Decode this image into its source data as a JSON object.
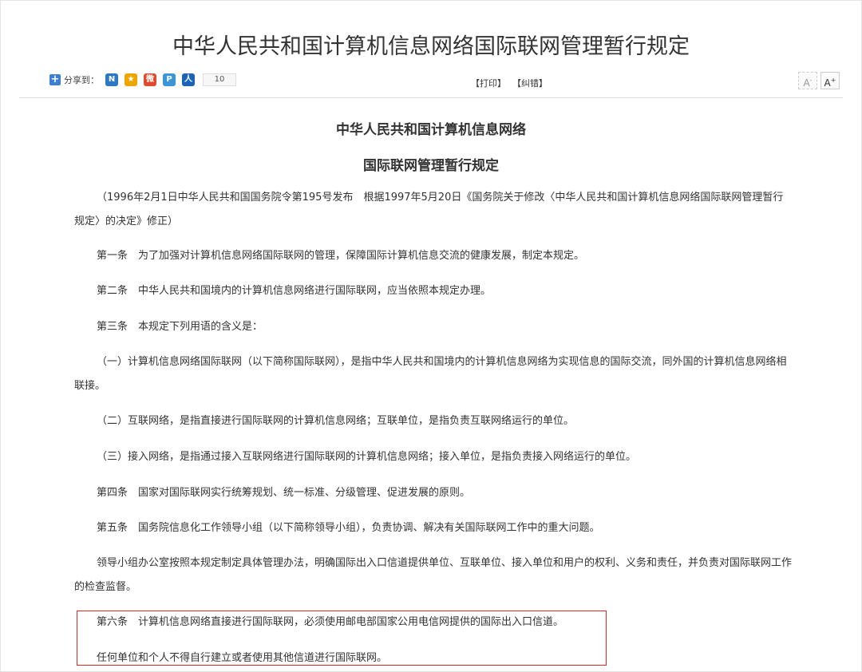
{
  "page": {
    "title": "中华人民共和国计算机信息网络国际联网管理暂行规定"
  },
  "share": {
    "label": "分享到：",
    "count": "10",
    "services": [
      {
        "icon": "renren-icon",
        "glyph": "N"
      },
      {
        "icon": "qzone-icon",
        "glyph": "★"
      },
      {
        "icon": "weibo-icon",
        "glyph": "微"
      },
      {
        "icon": "tencent-weibo-icon",
        "glyph": "P"
      },
      {
        "icon": "people-icon",
        "glyph": "人"
      }
    ]
  },
  "toolbar": {
    "print_label": "【打印】",
    "correct_label": "【纠错】",
    "font_smaller": "A",
    "font_larger": "A"
  },
  "doc": {
    "heading_line1": "中华人民共和国计算机信息网络",
    "heading_line2": "国际联网管理暂行规定",
    "paragraphs": [
      "（1996年2月1日中华人民共和国国务院令第195号发布　根据1997年5月20日《国务院关于修改〈中华人民共和国计算机信息网络国际联网管理暂行规定〉的决定》修正）",
      "第一条　为了加强对计算机信息网络国际联网的管理，保障国际计算机信息交流的健康发展，制定本规定。",
      "第二条　中华人民共和国境内的计算机信息网络进行国际联网，应当依照本规定办理。",
      "第三条　本规定下列用语的含义是：",
      "（一）计算机信息网络国际联网（以下简称国际联网），是指中华人民共和国境内的计算机信息网络为实现信息的国际交流，同外国的计算机信息网络相联接。",
      "（二）互联网络，是指直接进行国际联网的计算机信息网络；互联单位，是指负责互联网络运行的单位。",
      "（三）接入网络，是指通过接入互联网络进行国际联网的计算机信息网络；接入单位，是指负责接入网络运行的单位。",
      "第四条　国家对国际联网实行统筹规划、统一标准、分级管理、促进发展的原则。",
      "第五条　国务院信息化工作领导小组（以下简称领导小组），负责协调、解决有关国际联网工作中的重大问题。",
      "领导小组办公室按照本规定制定具体管理办法，明确国际出入口信道提供单位、互联单位、接入单位和用户的权利、义务和责任，并负责对国际联网工作的检查监督。",
      "第六条　计算机信息网络直接进行国际联网，必须使用邮电部国家公用电信网提供的国际出入口信道。",
      "任何单位和个人不得自行建立或者使用其他信道进行国际联网。"
    ]
  },
  "colors": {
    "highlight_border": "#d42a2a",
    "text": "#333333",
    "divider": "#dddddd"
  }
}
